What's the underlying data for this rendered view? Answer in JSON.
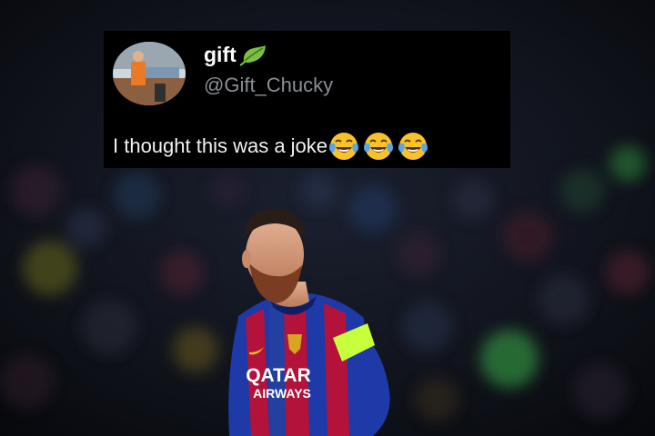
{
  "tweet": {
    "display_name": "gift",
    "handle": "@Gift_Chucky",
    "text": "I thought this was a joke",
    "emojis": [
      "face-with-tears-of-joy-emoji",
      "face-with-tears-of-joy-emoji",
      "face-with-tears-of-joy-emoji"
    ],
    "name_badge_icon": "leaf-icon"
  },
  "photo": {
    "sponsor_line1": "QATAR",
    "sponsor_line2": "AIRWAYS",
    "captain_band": "captain-armband"
  },
  "colors": {
    "card_bg": "#000000",
    "name": "#ffffff",
    "handle": "#8b8f94",
    "text": "#f2f2f2",
    "leaf": "#7bc043",
    "jersey_blue": "#1d3aa8",
    "jersey_red": "#b3123a",
    "armband": "#c7ff3c"
  }
}
